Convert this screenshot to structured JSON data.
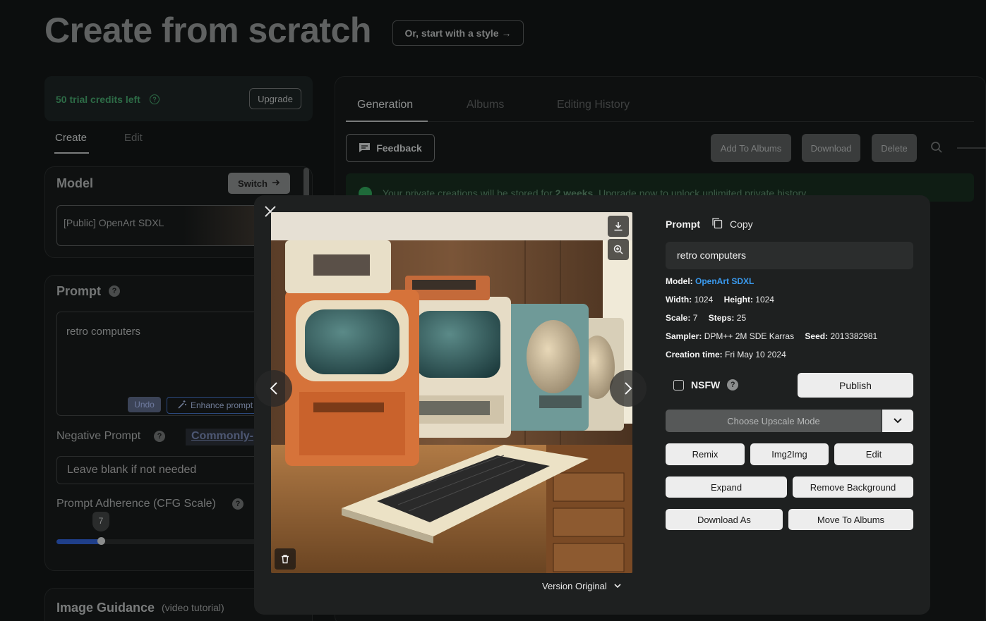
{
  "page": {
    "title": "Create from scratch",
    "style_button": "Or, start with a style →"
  },
  "sidebar": {
    "credits": "50 trial credits left",
    "upgrade": "Upgrade",
    "tabs": [
      "Create",
      "Edit"
    ],
    "model": {
      "title": "Model",
      "switch": "Switch",
      "value": "[Public] OpenArt SDXL"
    },
    "prompt": {
      "title": "Prompt",
      "value": "retro computers",
      "undo": "Undo",
      "enhance": "Enhance prompt"
    },
    "negative": {
      "label": "Negative Prompt",
      "commonly": "Commonly-",
      "placeholder": "Leave blank if not needed"
    },
    "cfg": {
      "label": "Prompt Adherence (CFG Scale)",
      "value": "7"
    },
    "guidance": {
      "title": "Image Guidance",
      "tutorial": "(video tutorial)"
    }
  },
  "main": {
    "tabs": [
      "Generation",
      "Albums",
      "Editing History"
    ],
    "feedback": "Feedback",
    "add_to_albums": "Add To Albums",
    "download": "Download",
    "delete": "Delete",
    "notice_start": "Your private creations will be stored for ",
    "notice_bold": "2 weeks",
    "notice_end": ". Upgrade now to unlock unlimited private history"
  },
  "modal": {
    "prompt_label": "Prompt",
    "copy": "Copy",
    "prompt_value": "retro computers",
    "model_label": "Model:",
    "model_value": "OpenArt SDXL",
    "width_label": "Width:",
    "width_value": "1024",
    "height_label": "Height:",
    "height_value": "1024",
    "scale_label": "Scale:",
    "scale_value": "7",
    "steps_label": "Steps:",
    "steps_value": "25",
    "sampler_label": "Sampler:",
    "sampler_value": "DPM++ 2M SDE Karras",
    "seed_label": "Seed:",
    "seed_value": "2013382981",
    "creation_label": "Creation time:",
    "creation_value": "Fri May 10 2024",
    "nsfw": "NSFW",
    "publish": "Publish",
    "upscale": "Choose Upscale Mode",
    "remix": "Remix",
    "img2img": "Img2Img",
    "edit": "Edit",
    "expand": "Expand",
    "remove_bg": "Remove Background",
    "download_as": "Download As",
    "move_to_albums": "Move To Albums",
    "version": "Version Original"
  },
  "colors": {
    "modal_bg": "#1e2020",
    "link": "#3a9bf0",
    "button_light": "#ededed",
    "credits_green": "#2d6b46"
  }
}
